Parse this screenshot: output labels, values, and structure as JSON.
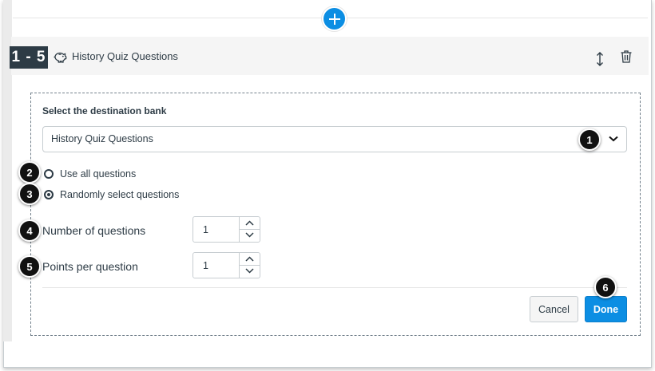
{
  "header": {
    "range_badge": "1 - 5",
    "bank_title": "History Quiz Questions"
  },
  "panel": {
    "destination_label": "Select the destination bank",
    "destination_value": "History Quiz Questions",
    "radio_all_label": "Use all questions",
    "radio_random_label": "Randomly select questions",
    "radio_selected": "random",
    "num_questions_label": "Number of questions",
    "num_questions_value": "1",
    "points_label": "Points per question",
    "points_value": "1",
    "cancel_label": "Cancel",
    "done_label": "Done"
  },
  "callouts": [
    "1",
    "2",
    "3",
    "4",
    "5",
    "6"
  ],
  "icons": {
    "add": "plus-icon",
    "bank": "piggy-bank-icon",
    "move": "move-vertical-icon",
    "delete": "trash-icon",
    "select": "chevron-down-icon"
  },
  "colors": {
    "accent": "#0c8ee3",
    "text": "#2d3b45",
    "header_bg": "#f5f5f5",
    "badge_bg": "#2d3b45"
  }
}
